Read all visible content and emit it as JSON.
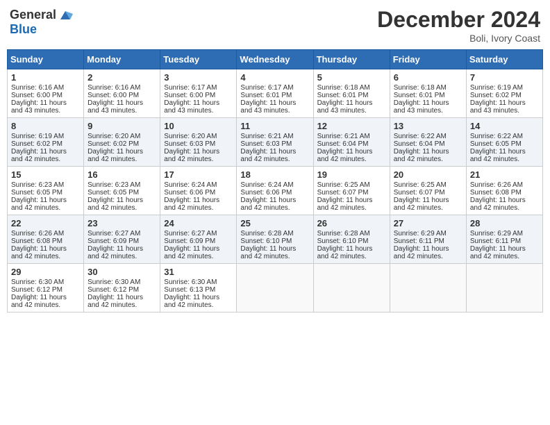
{
  "logo": {
    "general": "General",
    "blue": "Blue"
  },
  "header": {
    "title": "December 2024",
    "location": "Boli, Ivory Coast"
  },
  "weekdays": [
    "Sunday",
    "Monday",
    "Tuesday",
    "Wednesday",
    "Thursday",
    "Friday",
    "Saturday"
  ],
  "weeks": [
    [
      {
        "day": "1",
        "sunrise": "Sunrise: 6:16 AM",
        "sunset": "Sunset: 6:00 PM",
        "daylight": "Daylight: 11 hours and 43 minutes."
      },
      {
        "day": "2",
        "sunrise": "Sunrise: 6:16 AM",
        "sunset": "Sunset: 6:00 PM",
        "daylight": "Daylight: 11 hours and 43 minutes."
      },
      {
        "day": "3",
        "sunrise": "Sunrise: 6:17 AM",
        "sunset": "Sunset: 6:00 PM",
        "daylight": "Daylight: 11 hours and 43 minutes."
      },
      {
        "day": "4",
        "sunrise": "Sunrise: 6:17 AM",
        "sunset": "Sunset: 6:01 PM",
        "daylight": "Daylight: 11 hours and 43 minutes."
      },
      {
        "day": "5",
        "sunrise": "Sunrise: 6:18 AM",
        "sunset": "Sunset: 6:01 PM",
        "daylight": "Daylight: 11 hours and 43 minutes."
      },
      {
        "day": "6",
        "sunrise": "Sunrise: 6:18 AM",
        "sunset": "Sunset: 6:01 PM",
        "daylight": "Daylight: 11 hours and 43 minutes."
      },
      {
        "day": "7",
        "sunrise": "Sunrise: 6:19 AM",
        "sunset": "Sunset: 6:02 PM",
        "daylight": "Daylight: 11 hours and 43 minutes."
      }
    ],
    [
      {
        "day": "8",
        "sunrise": "Sunrise: 6:19 AM",
        "sunset": "Sunset: 6:02 PM",
        "daylight": "Daylight: 11 hours and 42 minutes."
      },
      {
        "day": "9",
        "sunrise": "Sunrise: 6:20 AM",
        "sunset": "Sunset: 6:02 PM",
        "daylight": "Daylight: 11 hours and 42 minutes."
      },
      {
        "day": "10",
        "sunrise": "Sunrise: 6:20 AM",
        "sunset": "Sunset: 6:03 PM",
        "daylight": "Daylight: 11 hours and 42 minutes."
      },
      {
        "day": "11",
        "sunrise": "Sunrise: 6:21 AM",
        "sunset": "Sunset: 6:03 PM",
        "daylight": "Daylight: 11 hours and 42 minutes."
      },
      {
        "day": "12",
        "sunrise": "Sunrise: 6:21 AM",
        "sunset": "Sunset: 6:04 PM",
        "daylight": "Daylight: 11 hours and 42 minutes."
      },
      {
        "day": "13",
        "sunrise": "Sunrise: 6:22 AM",
        "sunset": "Sunset: 6:04 PM",
        "daylight": "Daylight: 11 hours and 42 minutes."
      },
      {
        "day": "14",
        "sunrise": "Sunrise: 6:22 AM",
        "sunset": "Sunset: 6:05 PM",
        "daylight": "Daylight: 11 hours and 42 minutes."
      }
    ],
    [
      {
        "day": "15",
        "sunrise": "Sunrise: 6:23 AM",
        "sunset": "Sunset: 6:05 PM",
        "daylight": "Daylight: 11 hours and 42 minutes."
      },
      {
        "day": "16",
        "sunrise": "Sunrise: 6:23 AM",
        "sunset": "Sunset: 6:05 PM",
        "daylight": "Daylight: 11 hours and 42 minutes."
      },
      {
        "day": "17",
        "sunrise": "Sunrise: 6:24 AM",
        "sunset": "Sunset: 6:06 PM",
        "daylight": "Daylight: 11 hours and 42 minutes."
      },
      {
        "day": "18",
        "sunrise": "Sunrise: 6:24 AM",
        "sunset": "Sunset: 6:06 PM",
        "daylight": "Daylight: 11 hours and 42 minutes."
      },
      {
        "day": "19",
        "sunrise": "Sunrise: 6:25 AM",
        "sunset": "Sunset: 6:07 PM",
        "daylight": "Daylight: 11 hours and 42 minutes."
      },
      {
        "day": "20",
        "sunrise": "Sunrise: 6:25 AM",
        "sunset": "Sunset: 6:07 PM",
        "daylight": "Daylight: 11 hours and 42 minutes."
      },
      {
        "day": "21",
        "sunrise": "Sunrise: 6:26 AM",
        "sunset": "Sunset: 6:08 PM",
        "daylight": "Daylight: 11 hours and 42 minutes."
      }
    ],
    [
      {
        "day": "22",
        "sunrise": "Sunrise: 6:26 AM",
        "sunset": "Sunset: 6:08 PM",
        "daylight": "Daylight: 11 hours and 42 minutes."
      },
      {
        "day": "23",
        "sunrise": "Sunrise: 6:27 AM",
        "sunset": "Sunset: 6:09 PM",
        "daylight": "Daylight: 11 hours and 42 minutes."
      },
      {
        "day": "24",
        "sunrise": "Sunrise: 6:27 AM",
        "sunset": "Sunset: 6:09 PM",
        "daylight": "Daylight: 11 hours and 42 minutes."
      },
      {
        "day": "25",
        "sunrise": "Sunrise: 6:28 AM",
        "sunset": "Sunset: 6:10 PM",
        "daylight": "Daylight: 11 hours and 42 minutes."
      },
      {
        "day": "26",
        "sunrise": "Sunrise: 6:28 AM",
        "sunset": "Sunset: 6:10 PM",
        "daylight": "Daylight: 11 hours and 42 minutes."
      },
      {
        "day": "27",
        "sunrise": "Sunrise: 6:29 AM",
        "sunset": "Sunset: 6:11 PM",
        "daylight": "Daylight: 11 hours and 42 minutes."
      },
      {
        "day": "28",
        "sunrise": "Sunrise: 6:29 AM",
        "sunset": "Sunset: 6:11 PM",
        "daylight": "Daylight: 11 hours and 42 minutes."
      }
    ],
    [
      {
        "day": "29",
        "sunrise": "Sunrise: 6:30 AM",
        "sunset": "Sunset: 6:12 PM",
        "daylight": "Daylight: 11 hours and 42 minutes."
      },
      {
        "day": "30",
        "sunrise": "Sunrise: 6:30 AM",
        "sunset": "Sunset: 6:12 PM",
        "daylight": "Daylight: 11 hours and 42 minutes."
      },
      {
        "day": "31",
        "sunrise": "Sunrise: 6:30 AM",
        "sunset": "Sunset: 6:13 PM",
        "daylight": "Daylight: 11 hours and 42 minutes."
      },
      null,
      null,
      null,
      null
    ]
  ]
}
